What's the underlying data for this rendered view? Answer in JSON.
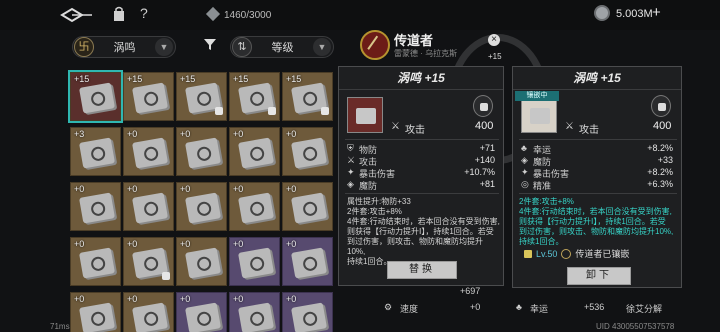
{
  "topbar": {
    "back_icon": "back-arrow-icon",
    "bag_icon": "bag-icon",
    "help_label": "?",
    "bag_count": "1460/3000",
    "money": "5.003M",
    "money_plus": "+"
  },
  "filters": {
    "type_label": "涡鸣",
    "sort_label": "等级"
  },
  "grid": {
    "rows": [
      [
        "+15",
        "+15",
        "+15",
        "+15",
        "+15"
      ],
      [
        "+3",
        "+0",
        "+0",
        "+0",
        "+0"
      ],
      [
        "+0",
        "+0",
        "+0",
        "+0",
        "+0"
      ],
      [
        "+0",
        "+0",
        "+0",
        "+0",
        "+0"
      ],
      [
        "+0",
        "+0",
        "+0",
        "+0",
        "+0"
      ]
    ]
  },
  "hero": {
    "name": "传道者",
    "subtitle": "雷蒙德 · 乌拉克斯",
    "ring_label": "+15"
  },
  "left_panel": {
    "title": "涡鸣 +15",
    "main_stat_label": "攻击",
    "main_stat_value": "400",
    "stats": [
      {
        "icon": "shield-icon",
        "label": "物防",
        "value": "+71"
      },
      {
        "icon": "sword-icon",
        "label": "攻击",
        "value": "+140"
      },
      {
        "icon": "crit-icon",
        "label": "暴击伤害",
        "value": "+10.7%"
      },
      {
        "icon": "magic-def-icon",
        "label": "魔防",
        "value": "+81"
      }
    ],
    "desc_title": "属性提升:物防+33",
    "desc_lines": [
      "2件套:攻击+8%",
      "4件套:行动结束时，若本回合没有受到伤害,",
      "则获得【行动力提升Ⅰ】，持续1回合。若受",
      "到过伤害，则攻击、物防和魔防均提升10%,",
      "持续1回合。"
    ],
    "button": "替换"
  },
  "right_panel": {
    "title": "涡鸣 +15",
    "equipped_tag": "镶嵌中",
    "main_stat_label": "攻击",
    "main_stat_value": "400",
    "stats": [
      {
        "icon": "luck-icon",
        "label": "幸运",
        "value": "+8.2%"
      },
      {
        "icon": "magic-def-icon",
        "label": "魔防",
        "value": "+33"
      },
      {
        "icon": "crit-icon",
        "label": "暴击伤害",
        "value": "+8.2%"
      },
      {
        "icon": "accuracy-icon",
        "label": "精准",
        "value": "+6.3%"
      }
    ],
    "desc_lines": [
      "2件套:攻击+8%",
      "4件套:行动结束时，若本回合没有受到伤害,",
      "则获得【行动力提升Ⅰ】，持续1回合。若受",
      "到过伤害，则攻击、物防和魔防均提升10%,",
      "持续1回合。"
    ],
    "status_level": "Lv.50",
    "status_text": "传道者已镶嵌",
    "button": "卸下"
  },
  "bottom": {
    "speed_label": "速度",
    "speed_value": "+0",
    "luck_label": "幸运",
    "luck_value": "+536",
    "decompose": "徐艾分解",
    "partial_value": "+697"
  },
  "footer": {
    "fps": "71ms",
    "uid": "UID 43005507537578"
  }
}
